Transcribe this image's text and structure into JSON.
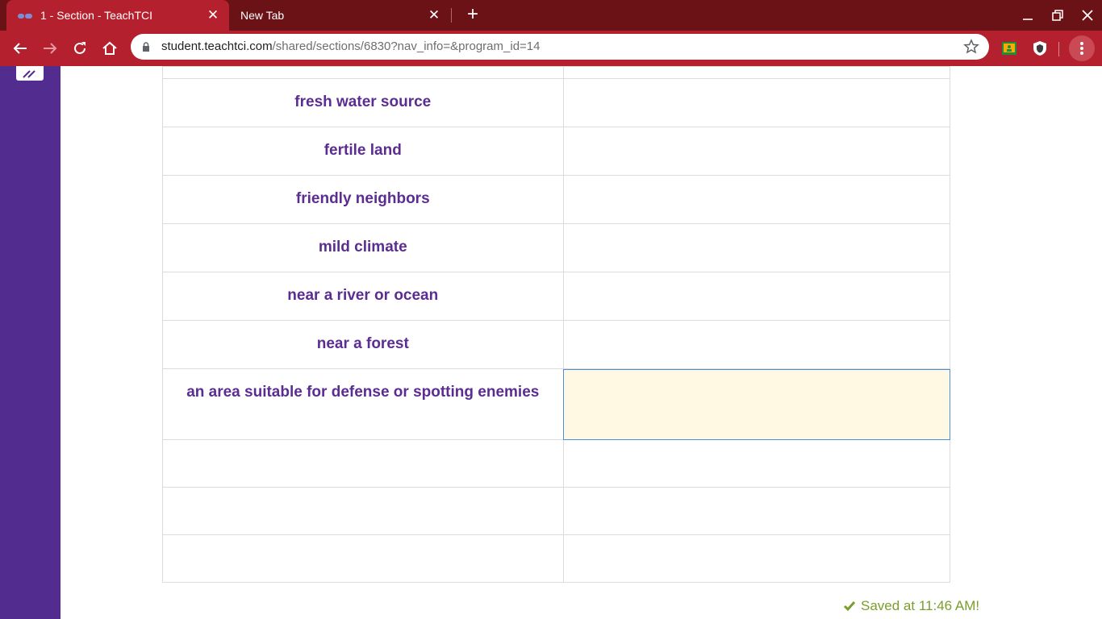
{
  "browser": {
    "tabs": [
      {
        "title": "1 - Section - TeachTCI",
        "active": true
      },
      {
        "title": "New Tab",
        "active": false
      }
    ],
    "url_host": "student.teachtci.com",
    "url_path": "/shared/sections/6830?nav_info=&program_id=14",
    "colors": {
      "tabbar": "#6b1216",
      "toolbar": "#b5202e"
    }
  },
  "sidebar": {
    "toggle_icon": "double-chevron-icon",
    "color": "#522d8f"
  },
  "table": {
    "rows": [
      {
        "label": "",
        "answer": ""
      },
      {
        "label": "fresh water source",
        "answer": ""
      },
      {
        "label": "fertile land",
        "answer": ""
      },
      {
        "label": "friendly neighbors",
        "answer": ""
      },
      {
        "label": "mild climate",
        "answer": ""
      },
      {
        "label": "near a river or ocean",
        "answer": ""
      },
      {
        "label": "near a forest",
        "answer": ""
      },
      {
        "label": "an area suitable for defense or spotting enemies",
        "answer": "",
        "focused": true
      },
      {
        "label": "",
        "answer": ""
      },
      {
        "label": "",
        "answer": ""
      },
      {
        "label": "",
        "answer": ""
      }
    ],
    "label_color": "#5c2d91"
  },
  "status": {
    "saved_text": "Saved at 11:46 AM!",
    "color": "#7a9e2e"
  }
}
